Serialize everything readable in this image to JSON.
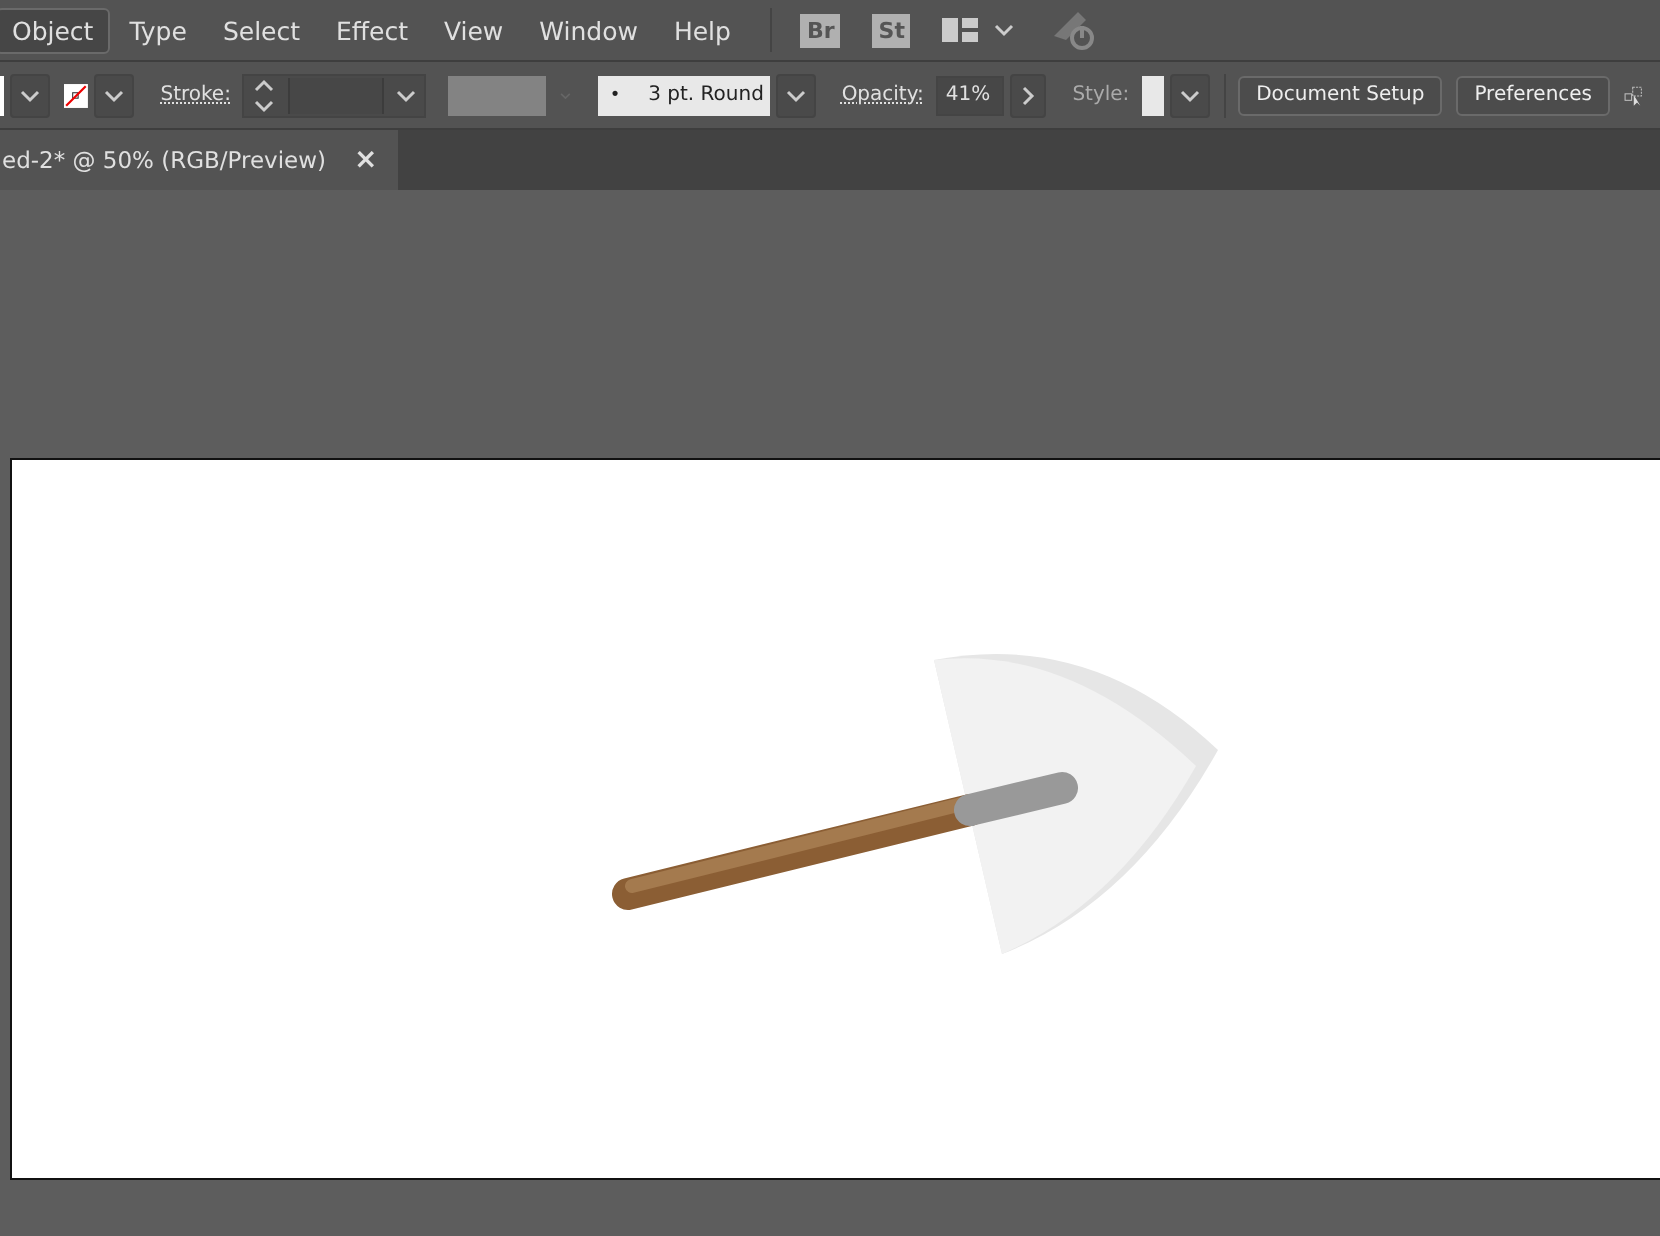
{
  "menu": [
    {
      "label": "Object",
      "selected": true
    },
    {
      "label": "Type",
      "selected": false
    },
    {
      "label": "Select",
      "selected": false
    },
    {
      "label": "Effect",
      "selected": false
    },
    {
      "label": "View",
      "selected": false
    },
    {
      "label": "Window",
      "selected": false
    },
    {
      "label": "Help",
      "selected": false
    }
  ],
  "app_icons": [
    "Br",
    "St"
  ],
  "control_bar": {
    "stroke_label": "Stroke:",
    "brush": "3 pt. Round",
    "brush_dot": "•",
    "opacity_label": "Opacity:",
    "opacity": "41%",
    "style_label": "Style:",
    "buttons": [
      "Document Setup",
      "Preferences"
    ]
  },
  "document_tab": {
    "title": "ed-2* @ 50% (RGB/Preview)",
    "close": "×"
  }
}
